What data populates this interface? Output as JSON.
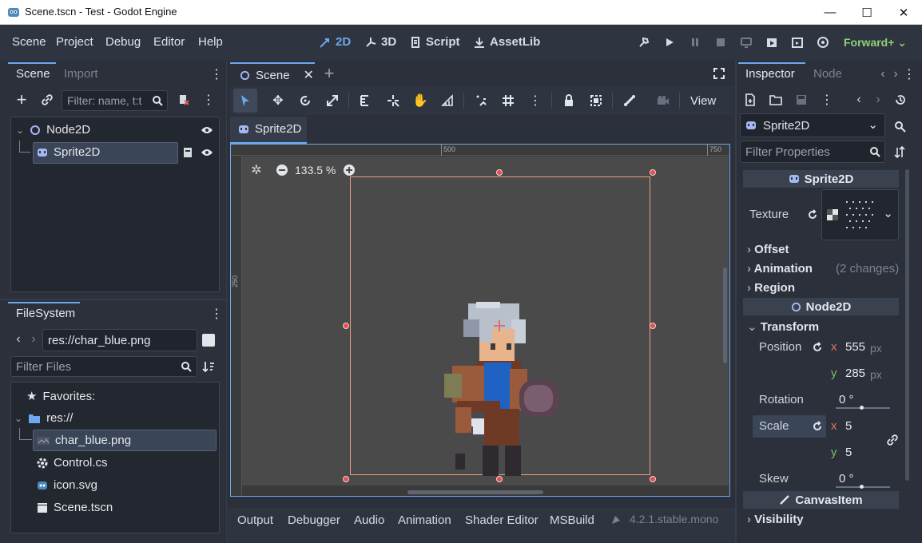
{
  "window": {
    "title": "Scene.tscn - Test - Godot Engine",
    "minimize": "—",
    "maximize": "☐",
    "close": "✕"
  },
  "menu": [
    "Scene",
    "Project",
    "Debug",
    "Editor",
    "Help"
  ],
  "workspaces": {
    "two_d": "2D",
    "three_d": "3D",
    "script": "Script",
    "assetlib": "AssetLib"
  },
  "renderer": "Forward+",
  "scene_dock": {
    "tabs": [
      "Scene",
      "Import"
    ],
    "filter_placeholder": "Filter: name, t:t",
    "tree": [
      {
        "label": "Node2D"
      },
      {
        "label": "Sprite2D"
      }
    ]
  },
  "filesystem": {
    "tab": "FileSystem",
    "path": "res://char_blue.png",
    "filter_placeholder": "Filter Files",
    "items": [
      {
        "label": "Favorites:"
      },
      {
        "label": "res://"
      },
      {
        "label": "char_blue.png"
      },
      {
        "label": "Control.cs"
      },
      {
        "label": "icon.svg"
      },
      {
        "label": "Scene.tscn"
      }
    ]
  },
  "editor": {
    "scene_tab": "Scene",
    "node_tab": "Sprite2D",
    "view_label": "View",
    "zoom": "133.5 %",
    "ruler_top": [
      "500",
      "750"
    ],
    "ruler_left": [
      "250"
    ]
  },
  "bottom_tabs": [
    "Output",
    "Debugger",
    "Audio",
    "Animation",
    "Shader Editor",
    "MSBuild"
  ],
  "version": "4.2.1.stable.mono",
  "inspector": {
    "tabs": [
      "Inspector",
      "Node"
    ],
    "selected_node": "Sprite2D",
    "filter_placeholder": "Filter Properties",
    "class_header": "Sprite2D",
    "texture_label": "Texture",
    "sections_sprite": [
      {
        "label": "Offset",
        "note": ""
      },
      {
        "label": "Animation",
        "note": "(2 changes)"
      },
      {
        "label": "Region",
        "note": ""
      }
    ],
    "node2d_header": "Node2D",
    "transform": {
      "label": "Transform",
      "position_label": "Position",
      "position_x": "555",
      "position_y": "285",
      "unit": "px",
      "rotation_label": "Rotation",
      "rotation": "0 °",
      "scale_label": "Scale",
      "scale_x": "5",
      "scale_y": "5",
      "skew_label": "Skew",
      "skew": "0 °",
      "x": "x",
      "y": "y"
    },
    "canvasitem_header": "CanvasItem",
    "visibility_label": "Visibility"
  }
}
